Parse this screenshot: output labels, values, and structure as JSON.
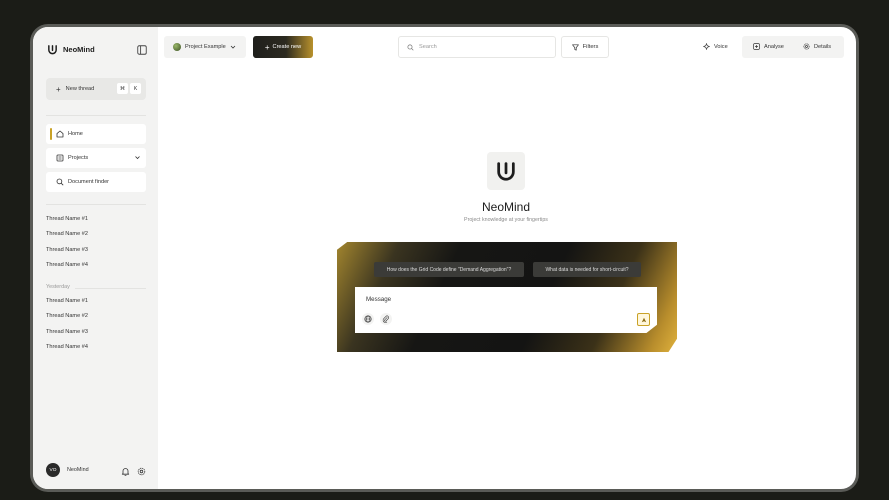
{
  "app": {
    "brand": "NeoMind"
  },
  "sidebar": {
    "new_thread": {
      "label": "New thread",
      "keys": [
        "⌘",
        "K"
      ]
    },
    "nav": [
      {
        "label": "Home",
        "icon": "home-icon",
        "active": true
      },
      {
        "label": "Projects",
        "icon": "projects-icon"
      },
      {
        "label": "Document finder",
        "icon": "search-icon"
      }
    ],
    "threads_recent": [
      "Thread Name #1",
      "Thread Name #2",
      "Thread Name #3",
      "Thread Name #4"
    ],
    "section_yesterday": "Yesterday",
    "threads_yesterday": [
      "Thread Name #1",
      "Thread Name #2",
      "Thread Name #3",
      "Thread Name #4"
    ],
    "user": {
      "initials": "VO",
      "name": "NeoMind"
    }
  },
  "toolbar": {
    "project": "Project Example",
    "create": "Create new",
    "search_placeholder": "Search",
    "filters": "Filters",
    "voice": "Voice",
    "analyse": "Analyse",
    "details": "Details"
  },
  "hero": {
    "title": "NeoMind",
    "subtitle": "Project knowledge at your fingertips"
  },
  "composer": {
    "suggestions": [
      "How does the Grid Code define \"Demand Aggregation\"?",
      "What data is needed for short-circuit?"
    ],
    "placeholder": "Message"
  },
  "colors": {
    "accent": "#c9a227",
    "dark": "#161614"
  }
}
